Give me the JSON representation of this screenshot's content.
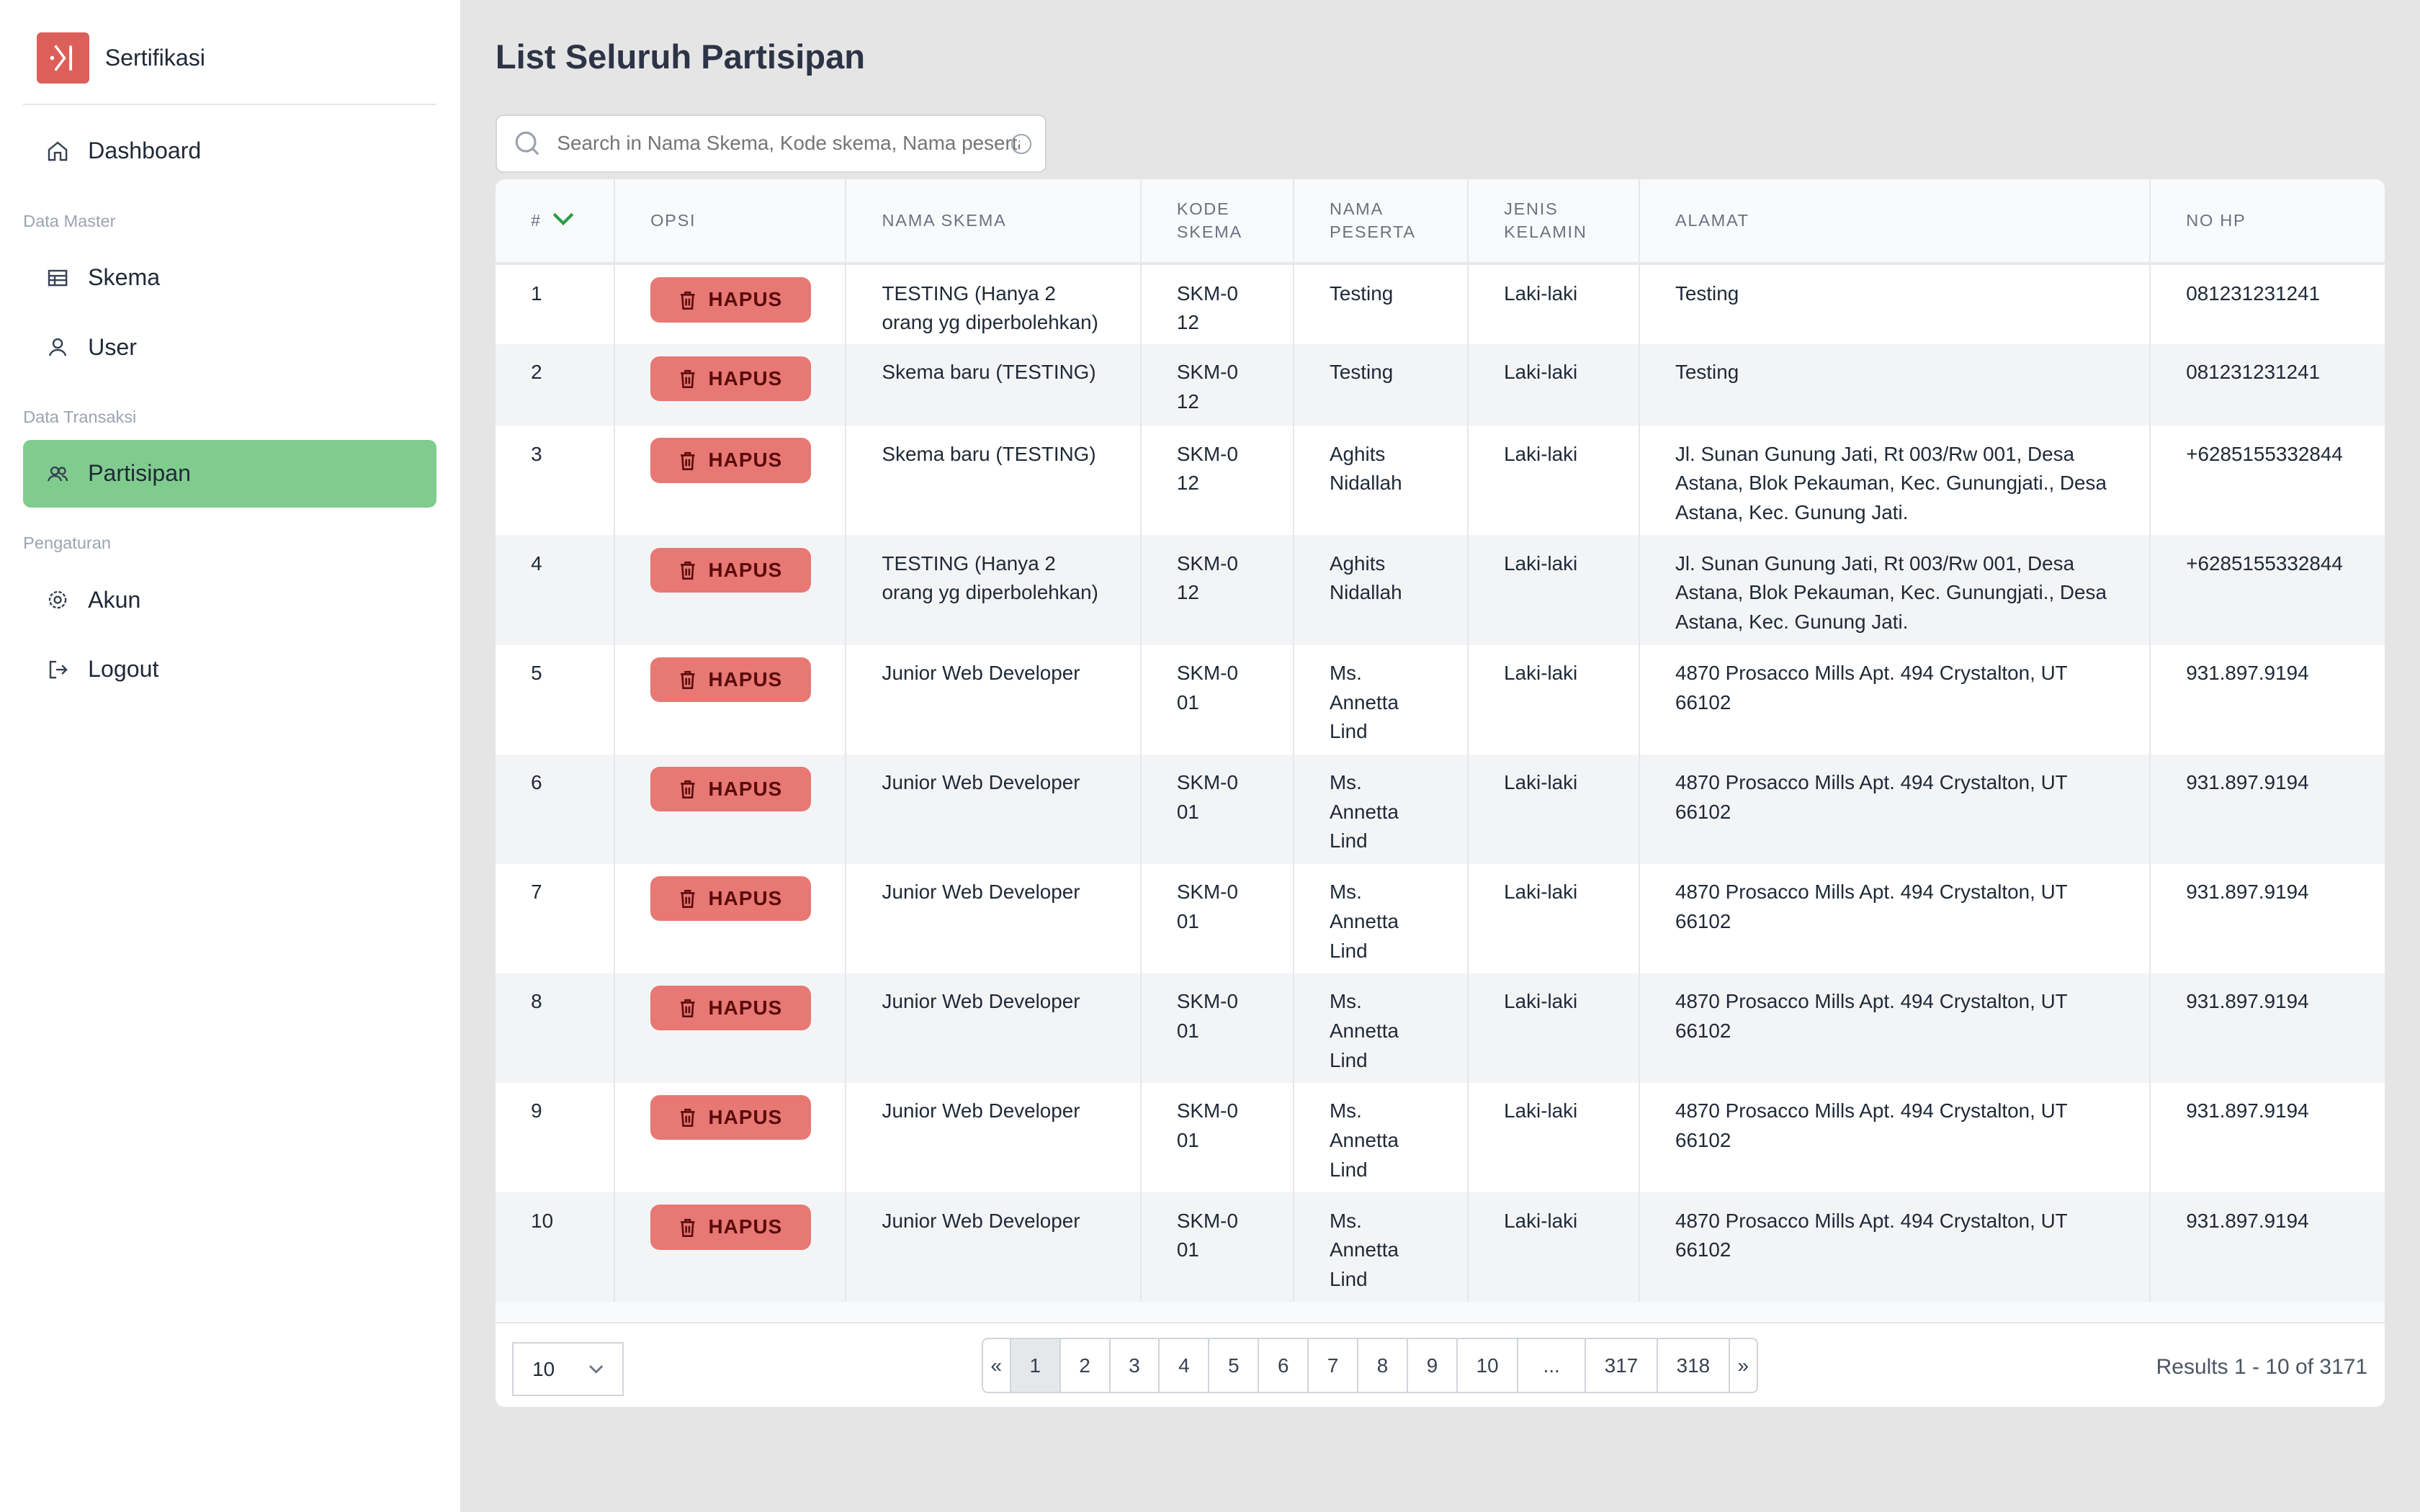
{
  "brand": {
    "name": "Sertifikasi"
  },
  "sidebar": {
    "dashboard": "Dashboard",
    "section_master": "Data Master",
    "skema": "Skema",
    "user": "User",
    "section_transaksi": "Data Transaksi",
    "partisipan": "Partisipan",
    "section_pengaturan": "Pengaturan",
    "akun": "Akun",
    "logout": "Logout"
  },
  "page": {
    "title": "List Seluruh Partisipan"
  },
  "search": {
    "placeholder": "Search in Nama Skema, Kode skema, Nama peserta,"
  },
  "table": {
    "headers": [
      "#",
      "OPSI",
      "NAMA SKEMA",
      "KODE SKEMA",
      "NAMA PESERTA",
      "JENIS KELAMIN",
      "ALAMAT",
      "NO HP"
    ],
    "delete_label": "HAPUS",
    "rows": [
      {
        "no": "1",
        "skema": "TESTING (Hanya 2 orang yg diperbolehkan)",
        "kode": "SKM-012",
        "nama": "Testing",
        "jk": "Laki-laki",
        "alamat": "Testing",
        "hp": "081231231241"
      },
      {
        "no": "2",
        "skema": "Skema baru (TESTING)",
        "kode": "SKM-012",
        "nama": "Testing",
        "jk": "Laki-laki",
        "alamat": "Testing",
        "hp": "081231231241"
      },
      {
        "no": "3",
        "skema": "Skema baru (TESTING)",
        "kode": "SKM-012",
        "nama": "Aghits Nidallah",
        "jk": "Laki-laki",
        "alamat": "Jl. Sunan Gunung Jati, Rt 003/Rw 001, Desa Astana, Blok Pekauman, Kec. Gunungjati., Desa Astana, Kec. Gunung Jati.",
        "hp": "+6285155332844"
      },
      {
        "no": "4",
        "skema": "TESTING (Hanya 2 orang yg diperbolehkan)",
        "kode": "SKM-012",
        "nama": "Aghits Nidallah",
        "jk": "Laki-laki",
        "alamat": "Jl. Sunan Gunung Jati, Rt 003/Rw 001, Desa Astana, Blok Pekauman, Kec. Gunungjati., Desa Astana, Kec. Gunung Jati.",
        "hp": "+6285155332844"
      },
      {
        "no": "5",
        "skema": "Junior Web Developer",
        "kode": "SKM-001",
        "nama": "Ms. Annetta Lind",
        "jk": "Laki-laki",
        "alamat": "4870 Prosacco Mills Apt. 494 Crystalton, UT 66102",
        "hp": "931.897.9194"
      },
      {
        "no": "6",
        "skema": "Junior Web Developer",
        "kode": "SKM-001",
        "nama": "Ms. Annetta Lind",
        "jk": "Laki-laki",
        "alamat": "4870 Prosacco Mills Apt. 494 Crystalton, UT 66102",
        "hp": "931.897.9194"
      },
      {
        "no": "7",
        "skema": "Junior Web Developer",
        "kode": "SKM-001",
        "nama": "Ms. Annetta Lind",
        "jk": "Laki-laki",
        "alamat": "4870 Prosacco Mills Apt. 494 Crystalton, UT 66102",
        "hp": "931.897.9194"
      },
      {
        "no": "8",
        "skema": "Junior Web Developer",
        "kode": "SKM-001",
        "nama": "Ms. Annetta Lind",
        "jk": "Laki-laki",
        "alamat": "4870 Prosacco Mills Apt. 494 Crystalton, UT 66102",
        "hp": "931.897.9194"
      },
      {
        "no": "9",
        "skema": "Junior Web Developer",
        "kode": "SKM-001",
        "nama": "Ms. Annetta Lind",
        "jk": "Laki-laki",
        "alamat": "4870 Prosacco Mills Apt. 494 Crystalton, UT 66102",
        "hp": "931.897.9194"
      },
      {
        "no": "10",
        "skema": "Junior Web Developer",
        "kode": "SKM-001",
        "nama": "Ms. Annetta Lind",
        "jk": "Laki-laki",
        "alamat": "4870 Prosacco Mills Apt. 494 Crystalton, UT 66102",
        "hp": "931.897.9194"
      }
    ]
  },
  "footer": {
    "per_page": "10",
    "pages": [
      "«",
      "1",
      "2",
      "3",
      "4",
      "5",
      "6",
      "7",
      "8",
      "9",
      "10",
      "...",
      "317",
      "318",
      "»"
    ],
    "current_page": "1",
    "results": "Results 1 - 10 of 3171"
  }
}
